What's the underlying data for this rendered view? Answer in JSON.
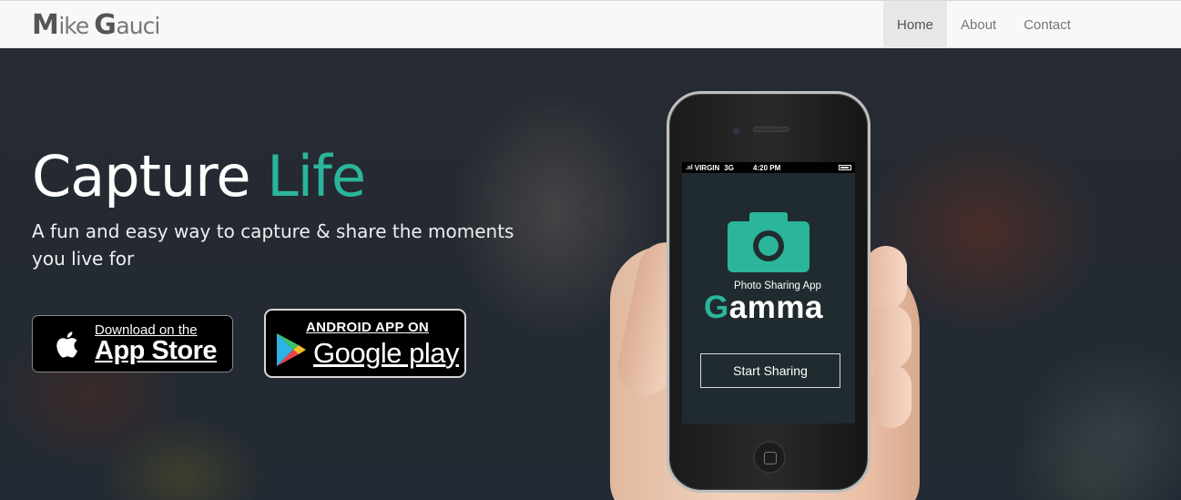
{
  "navbar": {
    "brand": {
      "first_initial": "M",
      "first_rest": "ike",
      "last_initial": "G",
      "last_rest": "auci"
    },
    "links": [
      {
        "label": "Home",
        "active": true
      },
      {
        "label": "About",
        "active": false
      },
      {
        "label": "Contact",
        "active": false
      }
    ]
  },
  "hero": {
    "headline_main": "Capture",
    "headline_accent": "Life",
    "subtitle": "A fun and easy way to capture & share the moments you live for",
    "appstore": {
      "small": "Download on the",
      "big": "App Store",
      "icon": "apple-icon"
    },
    "googleplay": {
      "small": "ANDROID APP ON",
      "big": "Google play",
      "icon": "google-play-icon"
    }
  },
  "phone": {
    "status": {
      "carrier": "VIRGIN",
      "network": "3G",
      "time": "4:20 PM"
    },
    "app_tagline": "Photo Sharing App",
    "app_name_initial": "G",
    "app_name_rest": "amma",
    "start_button": "Start Sharing",
    "icon": "camera-icon"
  },
  "colors": {
    "accent": "#2bb59a",
    "navbar_bg": "#f8f8f8",
    "active_nav_bg": "#e7e7e7",
    "hero_overlay": "#2a3038"
  }
}
